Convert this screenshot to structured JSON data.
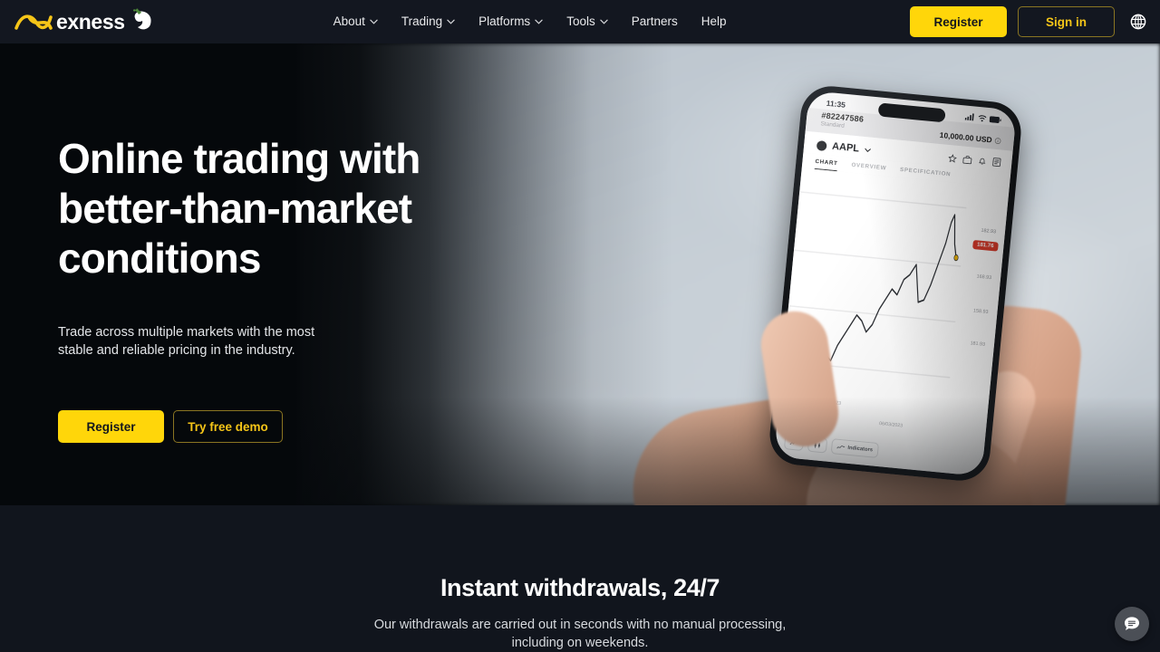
{
  "nav": {
    "logo": {
      "text": "exness",
      "mark_icon": "exness-x-mark",
      "dove_icon": "dove-icon"
    },
    "links": [
      {
        "label": "About",
        "has_caret": true
      },
      {
        "label": "Trading",
        "has_caret": true
      },
      {
        "label": "Platforms",
        "has_caret": true
      },
      {
        "label": "Tools",
        "has_caret": true
      },
      {
        "label": "Partners",
        "has_caret": false
      },
      {
        "label": "Help",
        "has_caret": false
      }
    ],
    "register_label": "Register",
    "signin_label": "Sign in",
    "language_icon": "globe-icon"
  },
  "hero": {
    "headline_line1": "Online trading with",
    "headline_line2": "better-than-market",
    "headline_line3": "conditions",
    "subtext": "Trade across multiple markets with the most stable and reliable pricing in the industry.",
    "register_label": "Register",
    "demo_label": "Try free demo"
  },
  "phone": {
    "time": "11:35",
    "account_id": "#82247586",
    "account_type": "Standard",
    "balance": "10,000.00 USD",
    "symbol": "AAPL",
    "tabs": [
      "CHART",
      "OVERVIEW",
      "SPECIFICATION"
    ],
    "active_tab": "CHART",
    "price_badge": "181.76",
    "price_top": "182.93",
    "y_labels": [
      "168.93",
      "158.93",
      "181.93"
    ],
    "x_labels": [
      "16/05/2023",
      "06/03/2023"
    ],
    "indicators_label": "Indicators"
  },
  "section2": {
    "title": "Instant withdrawals, 24/7",
    "subtitle": "Our withdrawals are carried out in seconds with no manual processing, including on weekends."
  },
  "chat": {
    "icon": "chat-bubble-icon"
  },
  "colors": {
    "brand_yellow": "#FFD60A",
    "signin_yellow": "#F5C518",
    "nav_bg": "#131720",
    "section_bg": "#11151d",
    "price_badge_red": "#d93b2b"
  }
}
